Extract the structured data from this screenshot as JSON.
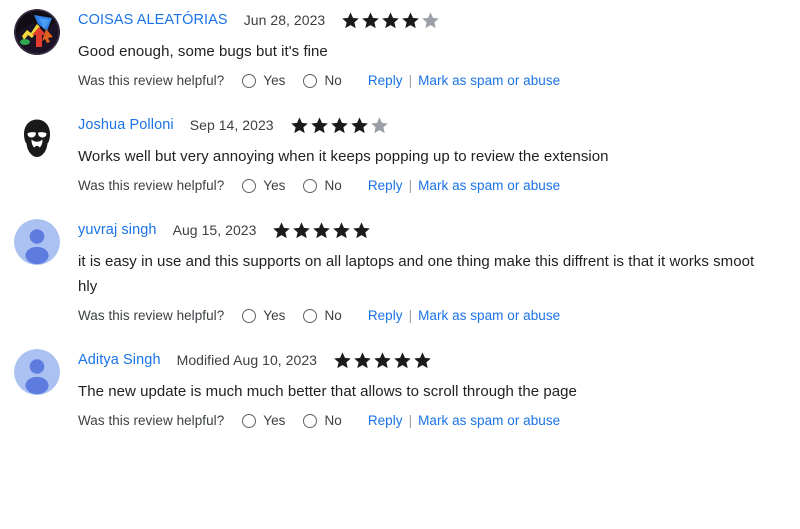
{
  "theme": {
    "link_color": "#1a73e8",
    "text_color": "#202124",
    "secondary_text_color": "#3c4043",
    "star_filled_color": "#1b1b1b",
    "star_empty_color": "#9aa0a6",
    "avatar_default_bg": "#aac1f2",
    "avatar_default_fg": "#5e7ce0",
    "background": "#ffffff"
  },
  "labels": {
    "helpful_question": "Was this review helpful?",
    "yes": "Yes",
    "no": "No",
    "reply": "Reply",
    "separator": "|",
    "mark_spam": "Mark as spam or abuse"
  },
  "reviews": [
    {
      "author": "COISAS ALEATÓRIAS",
      "date": "Jun 28, 2023",
      "rating": 4,
      "max_rating": 5,
      "text": "Good enough, some bugs but it's fine",
      "avatar_type": "photo-arrows",
      "avatar_alt": "dark circular logo with colored arrows"
    },
    {
      "author": "Joshua Polloni",
      "date": "Sep 14, 2023",
      "rating": 4,
      "max_rating": 5,
      "text": "Works well but very annoying when it keeps popping up to review the extension",
      "avatar_type": "photo-face",
      "avatar_alt": "black and white photo of a bearded man"
    },
    {
      "author": "yuvraj singh",
      "date": "Aug 15, 2023",
      "rating": 5,
      "max_rating": 5,
      "text": "it is easy in use and this supports on all laptops and one thing make this diffrent is that it works smoot hly",
      "avatar_type": "default-person",
      "avatar_alt": "default person avatar"
    },
    {
      "author": "Aditya Singh",
      "date": "Modified Aug 10, 2023",
      "rating": 5,
      "max_rating": 5,
      "text": "The new update is much much better that allows to scroll through the page",
      "avatar_type": "default-person",
      "avatar_alt": "default person avatar"
    }
  ]
}
